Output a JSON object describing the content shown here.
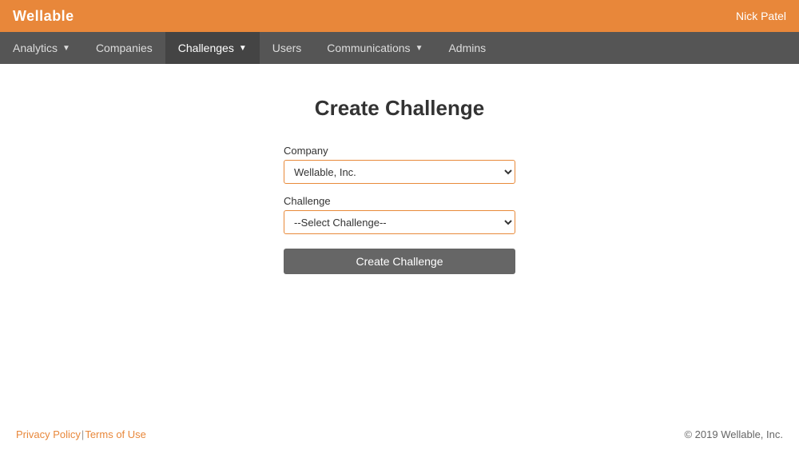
{
  "header": {
    "logo": "Wellable",
    "user_name": "Nick Patel"
  },
  "nav": {
    "items": [
      {
        "label": "Analytics",
        "has_arrow": true,
        "active": false
      },
      {
        "label": "Companies",
        "has_arrow": false,
        "active": false
      },
      {
        "label": "Challenges",
        "has_arrow": true,
        "active": true
      },
      {
        "label": "Users",
        "has_arrow": false,
        "active": false
      },
      {
        "label": "Communications",
        "has_arrow": true,
        "active": false
      },
      {
        "label": "Admins",
        "has_arrow": false,
        "active": false
      }
    ]
  },
  "main": {
    "title": "Create Challenge",
    "form": {
      "company_label": "Company",
      "company_value": "Wellable, Inc.",
      "challenge_label": "Challenge",
      "challenge_placeholder": "--Select Challenge--",
      "submit_label": "Create Challenge"
    }
  },
  "footer": {
    "privacy_policy": "Privacy Policy",
    "separator": " | ",
    "terms_of_use": "Terms of Use",
    "copyright": "© 2019 Wellable, Inc."
  }
}
